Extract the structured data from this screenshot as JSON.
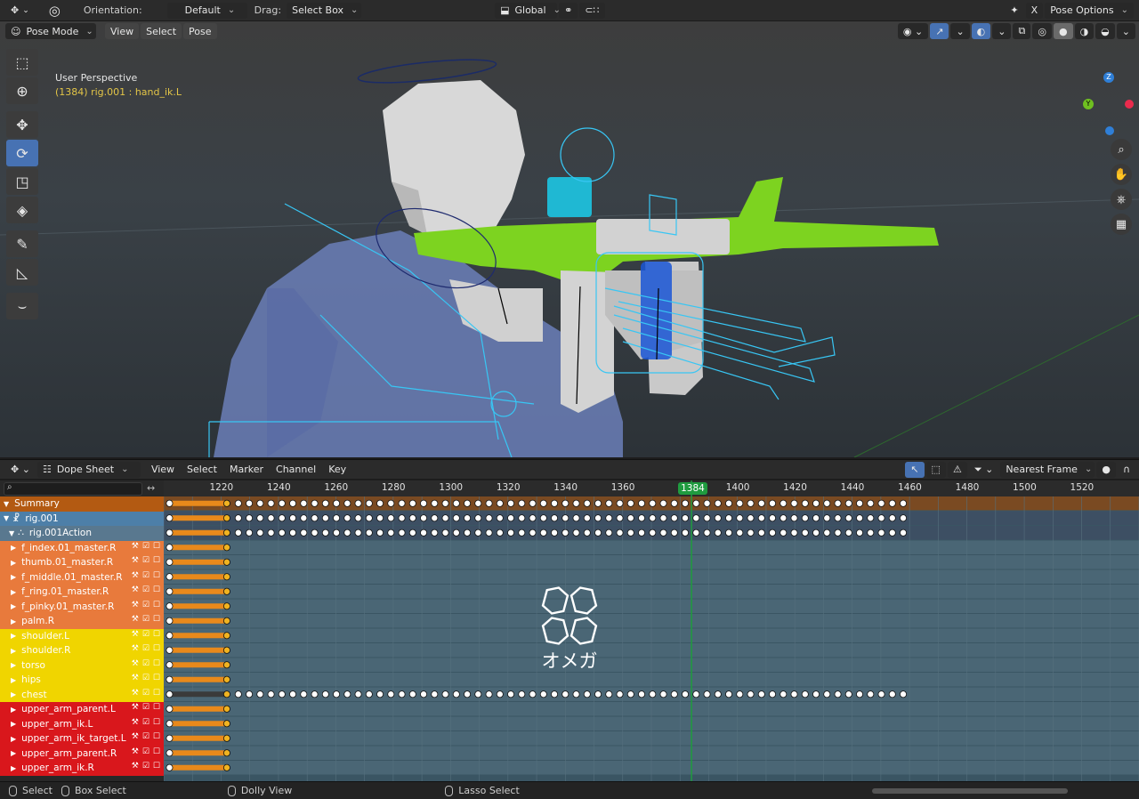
{
  "topbar": {
    "orientation_label": "Orientation:",
    "orientation_value": "Default",
    "drag_label": "Drag:",
    "drag_value": "Select Box",
    "transform_pivot": "Global",
    "xray_letter": "X",
    "pose_options": "Pose Options"
  },
  "viewport_header": {
    "mode": "Pose Mode",
    "menus": [
      "View",
      "Select",
      "Pose"
    ]
  },
  "viewport": {
    "perspective": "User Perspective",
    "active_object": "(1384) rig.001 : hand_ik.L",
    "gizmo_axes": [
      "Z",
      "Y"
    ]
  },
  "toolbar": {
    "tools": [
      "select-box",
      "cursor",
      "move",
      "rotate",
      "scale",
      "transform",
      "annotate",
      "measure",
      "relax-pose"
    ],
    "active_tool": "rotate"
  },
  "dope_sheet": {
    "editor_mode": "Dope Sheet",
    "menus": [
      "View",
      "Select",
      "Marker",
      "Channel",
      "Key"
    ],
    "snapping": "Nearest Frame",
    "search_placeholder": "",
    "current_frame": 1384,
    "ruler_ticks": [
      1220,
      1240,
      1260,
      1280,
      1300,
      1320,
      1340,
      1360,
      1400,
      1420,
      1440,
      1460,
      1480,
      1500,
      1520
    ],
    "frame_range_visible": [
      1200,
      1540
    ],
    "channels": [
      {
        "name": "Summary",
        "type": "summary",
        "color": "#b35a12"
      },
      {
        "name": "rig.001",
        "type": "object",
        "color": "#4d7fa8"
      },
      {
        "name": "rig.001Action",
        "type": "action",
        "color": "#59788f"
      },
      {
        "name": "f_index.01_master.R",
        "type": "bone",
        "color": "#e87a3c"
      },
      {
        "name": "thumb.01_master.R",
        "type": "bone",
        "color": "#e87a3c"
      },
      {
        "name": "f_middle.01_master.R",
        "type": "bone",
        "color": "#e87a3c"
      },
      {
        "name": "f_ring.01_master.R",
        "type": "bone",
        "color": "#e87a3c"
      },
      {
        "name": "f_pinky.01_master.R",
        "type": "bone",
        "color": "#e87a3c"
      },
      {
        "name": "palm.R",
        "type": "bone",
        "color": "#e87a3c"
      },
      {
        "name": "shoulder.L",
        "type": "bone",
        "color": "#f0d500"
      },
      {
        "name": "shoulder.R",
        "type": "bone",
        "color": "#f0d500"
      },
      {
        "name": "torso",
        "type": "bone",
        "color": "#f0d500"
      },
      {
        "name": "hips",
        "type": "bone",
        "color": "#f0d500"
      },
      {
        "name": "chest",
        "type": "bone",
        "color": "#f0d500"
      },
      {
        "name": "upper_arm_parent.L",
        "type": "bone",
        "color": "#d9171c"
      },
      {
        "name": "upper_arm_ik.L",
        "type": "bone",
        "color": "#d9171c"
      },
      {
        "name": "upper_arm_ik_target.L",
        "type": "bone",
        "color": "#d9171c"
      },
      {
        "name": "upper_arm_parent.R",
        "type": "bone",
        "color": "#d9171c"
      },
      {
        "name": "upper_arm_ik.R",
        "type": "bone",
        "color": "#d9171c"
      }
    ],
    "keyframe_rows": [
      {
        "row": 0,
        "frames": "dense",
        "start": 1202,
        "end": 1460
      },
      {
        "row": 1,
        "frames": "dense",
        "start": 1202,
        "end": 1460
      },
      {
        "row": 2,
        "frames": "dense",
        "start": 1202,
        "end": 1460
      },
      {
        "row": 13,
        "frames": "dense",
        "start": 1202,
        "end": 1460
      }
    ],
    "hold_range": [
      1202,
      1222
    ]
  },
  "statusbar": {
    "items": [
      "Select",
      "Box Select",
      "Dolly View",
      "Lasso Select"
    ]
  },
  "watermark": {
    "text": "オメガ"
  },
  "colors": {
    "accent": "#4772b3",
    "playhead": "#1f9b3f",
    "hold_bar": "#e8891b",
    "keyframe_fill": "#ffffff",
    "keyframe_selected": "#f0b321"
  }
}
